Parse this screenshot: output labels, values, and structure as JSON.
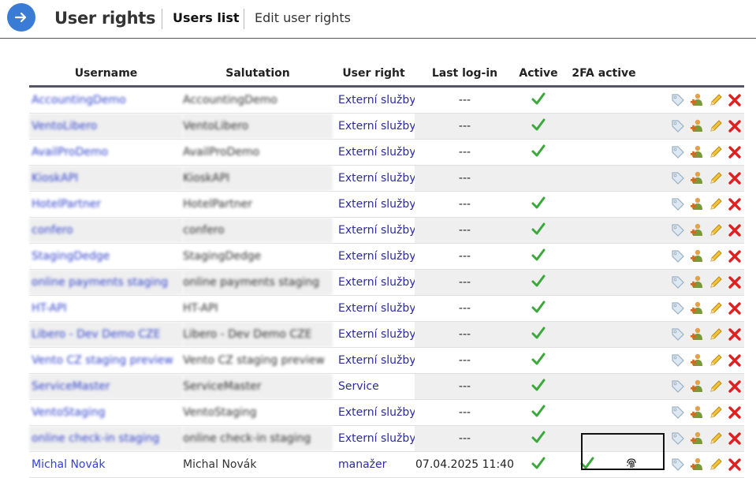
{
  "header": {
    "back_icon": "arrow-right-icon",
    "title": "User rights",
    "tabs": [
      {
        "label": "Users list",
        "active": true
      },
      {
        "label": "Edit user rights",
        "active": false
      }
    ]
  },
  "table": {
    "columns": [
      "Username",
      "Salutation",
      "User right",
      "Last log-in",
      "Active",
      "2FA active"
    ],
    "rows": [
      {
        "username": "AccountingDemo",
        "salutation": "AccountingDemo",
        "right": "Externí služby",
        "last": "---",
        "active": true,
        "twofa": false,
        "fingerprint": false,
        "blurred": true
      },
      {
        "username": "VentoLibero",
        "salutation": "VentoLibero",
        "right": "Externí služby",
        "last": "---",
        "active": true,
        "twofa": false,
        "fingerprint": false,
        "blurred": true
      },
      {
        "username": "AvailProDemo",
        "salutation": "AvailProDemo",
        "right": "Externí služby",
        "last": "---",
        "active": true,
        "twofa": false,
        "fingerprint": false,
        "blurred": true
      },
      {
        "username": "KioskAPI",
        "salutation": "KioskAPI",
        "right": "Externí služby",
        "last": "---",
        "active": false,
        "twofa": false,
        "fingerprint": false,
        "blurred": true
      },
      {
        "username": "HotelPartner",
        "salutation": "HotelPartner",
        "right": "Externí služby",
        "last": "---",
        "active": true,
        "twofa": false,
        "fingerprint": false,
        "blurred": true
      },
      {
        "username": "confero",
        "salutation": "confero",
        "right": "Externí služby",
        "last": "---",
        "active": true,
        "twofa": false,
        "fingerprint": false,
        "blurred": true
      },
      {
        "username": "StagingDedge",
        "salutation": "StagingDedge",
        "right": "Externí služby",
        "last": "---",
        "active": true,
        "twofa": false,
        "fingerprint": false,
        "blurred": true
      },
      {
        "username": "online payments staging",
        "salutation": "online payments staging",
        "right": "Externí služby",
        "last": "---",
        "active": true,
        "twofa": false,
        "fingerprint": false,
        "blurred": true
      },
      {
        "username": "HT-API",
        "salutation": "HT-API",
        "right": "Externí služby",
        "last": "---",
        "active": true,
        "twofa": false,
        "fingerprint": false,
        "blurred": true
      },
      {
        "username": "Libero - Dev Demo CZE",
        "salutation": "Libero - Dev Demo CZE",
        "right": "Externí služby",
        "last": "---",
        "active": true,
        "twofa": false,
        "fingerprint": false,
        "blurred": true
      },
      {
        "username": "Vento CZ staging preview",
        "salutation": "Vento CZ staging preview",
        "right": "Externí služby",
        "last": "---",
        "active": true,
        "twofa": false,
        "fingerprint": false,
        "blurred": true
      },
      {
        "username": "ServiceMaster",
        "salutation": "ServiceMaster",
        "right": "Service",
        "last": "---",
        "active": true,
        "twofa": false,
        "fingerprint": false,
        "blurred": true
      },
      {
        "username": "VentoStaging",
        "salutation": "VentoStaging",
        "right": "Externí služby",
        "last": "---",
        "active": true,
        "twofa": false,
        "fingerprint": false,
        "blurred": true
      },
      {
        "username": "online check-in staging",
        "salutation": "online check-in staging",
        "right": "Externí služby",
        "last": "---",
        "active": true,
        "twofa": false,
        "fingerprint": false,
        "blurred": true
      },
      {
        "username": "Michal Novák",
        "salutation": "Michal Novák",
        "right": "manažer",
        "last": "07.04.2025 11:40",
        "active": true,
        "twofa": true,
        "fingerprint": true,
        "blurred": false
      }
    ],
    "row_actions": [
      "tag-icon",
      "user-group-icon",
      "pencil-icon",
      "delete-x-icon"
    ]
  },
  "colors": {
    "accent": "#3a7bd5",
    "link": "#3344cc",
    "check": "#3aa83a",
    "delete": "#e02020",
    "row_alt": "#efefef"
  }
}
